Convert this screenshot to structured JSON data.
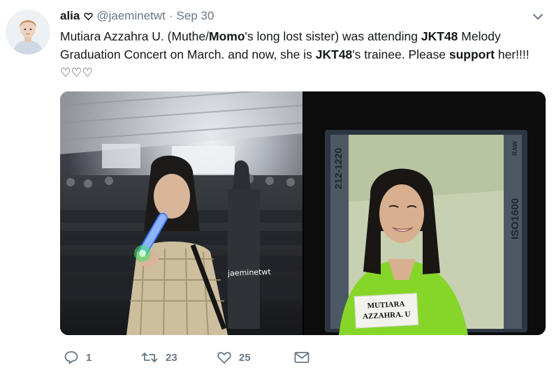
{
  "tweet": {
    "display_name": "alia",
    "handle": "@jaeminetwt",
    "separator": "·",
    "date": "Sep 30",
    "text_parts": {
      "p1": "Mutiara Azzahra U. (Muthe/",
      "b1": "Momo",
      "p2": "'s long lost sister) was attending ",
      "b2": "JKT48",
      "p3": " Melody Graduation Concert on March. and now, she is ",
      "b3": "JKT48",
      "p4": "'s trainee. Please ",
      "b4": "support",
      "p5": " her!!!!♡♡♡"
    }
  },
  "media": {
    "left_watermark": "jaeminetwt",
    "right_code": "212-1220",
    "right_iso": "ISO1600",
    "right_raw": "RAW",
    "nameplate_line1": "MUTIARA",
    "nameplate_line2": "AZZAHRA. U"
  },
  "actions": {
    "reply_count": "1",
    "retweet_count": "23",
    "like_count": "25"
  },
  "icons": {
    "badge": "heart-outline-icon",
    "caret": "chevron-down-icon",
    "reply": "reply-icon",
    "retweet": "retweet-icon",
    "like": "heart-icon",
    "dm": "envelope-icon"
  },
  "colors": {
    "text": "#14171a",
    "secondary": "#657786"
  }
}
